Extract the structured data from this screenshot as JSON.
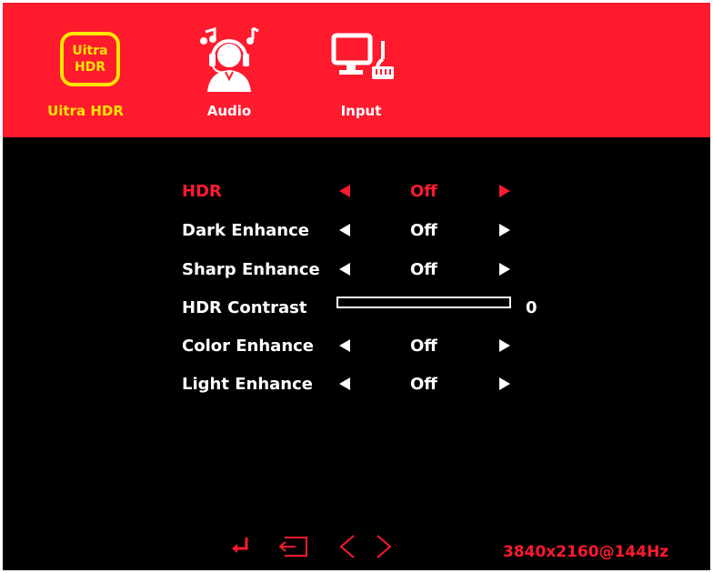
{
  "tabs": [
    {
      "id": "ultra-hdr",
      "label": "Uitra HDR",
      "icon_text_line1": "Uitra",
      "icon_text_line2": "HDR",
      "icon": "hdr-badge-icon",
      "active": true
    },
    {
      "id": "audio",
      "label": "Audio",
      "icon": "headset-music-icon",
      "active": false
    },
    {
      "id": "input",
      "label": "Input",
      "icon": "monitor-input-icon",
      "active": false
    }
  ],
  "menu": {
    "rows": [
      {
        "label": "HDR",
        "value": "Off",
        "selected": true
      },
      {
        "label": "Dark Enhance",
        "value": "Off",
        "selected": false
      },
      {
        "label": "Sharp Enhance",
        "value": "Off",
        "selected": false
      },
      {
        "label": "HDR Contrast",
        "slider_value": "0",
        "slider_fraction": 0
      },
      {
        "label": "Color Enhance",
        "value": "Off",
        "selected": false
      },
      {
        "label": "Light Enhance",
        "value": "Off",
        "selected": false
      }
    ]
  },
  "footer": {
    "nav_icons": [
      "enter-icon",
      "exit-icon",
      "left-chevron-icon",
      "right-chevron-icon"
    ],
    "resolution": "3840x2160@144Hz"
  },
  "colors": {
    "accent_red": "#ff1a2e",
    "active_yellow": "#ffe600",
    "background": "#000000",
    "text": "#ffffff"
  }
}
